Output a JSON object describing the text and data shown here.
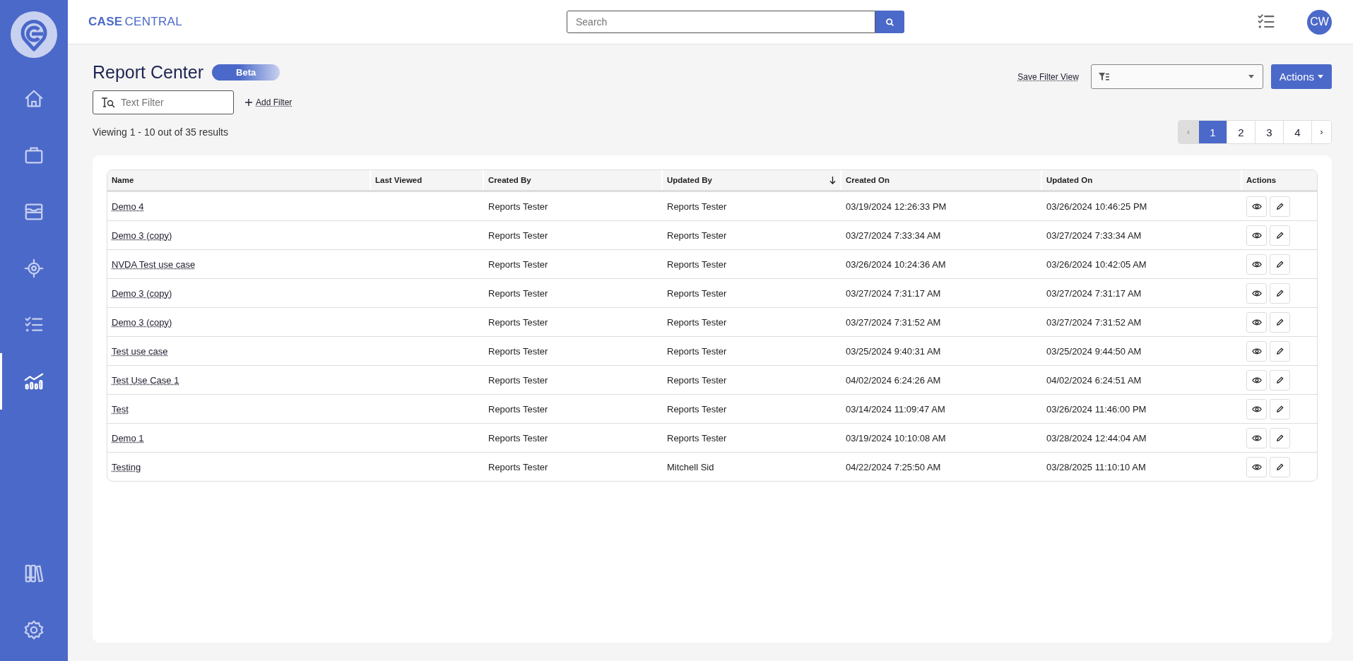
{
  "sidebar": {
    "items": [
      {
        "kind": "home",
        "selected": false
      },
      {
        "kind": "briefcase",
        "selected": false
      },
      {
        "kind": "inbox",
        "selected": false
      },
      {
        "kind": "target",
        "selected": false
      },
      {
        "kind": "checklist",
        "selected": false
      },
      {
        "kind": "chart",
        "selected": true
      }
    ],
    "bottom_items": [
      {
        "kind": "books",
        "selected": false
      },
      {
        "kind": "settings",
        "selected": false
      }
    ]
  },
  "header": {
    "brand_bold": "CASE",
    "brand_light": "CENTRAL",
    "search": {
      "placeholder": "Search"
    },
    "avatar": "CW"
  },
  "page": {
    "title": "Report Center",
    "badge": "Beta",
    "text_filter": {
      "placeholder": "Text Filter"
    },
    "add_filter": "Add Filter",
    "save_filter_view": "Save Filter View",
    "actions_button": "Actions",
    "result_summary": "Viewing 1 - 10 out of 35 results"
  },
  "pagination": {
    "prev": {
      "label": "‹",
      "disabled": true
    },
    "next": {
      "label": "›",
      "disabled": false
    },
    "pages": [
      {
        "label": "1",
        "selected": true
      },
      {
        "label": "2",
        "selected": false
      },
      {
        "label": "3",
        "selected": false
      },
      {
        "label": "4",
        "selected": false
      }
    ]
  },
  "table": {
    "columns": [
      {
        "label": "Name",
        "sorted": false
      },
      {
        "label": "Last Viewed",
        "sorted": false
      },
      {
        "label": "Created By",
        "sorted": false
      },
      {
        "label": "Updated By",
        "sorted": true
      },
      {
        "label": "Created On",
        "sorted": false
      },
      {
        "label": "Updated On",
        "sorted": false
      },
      {
        "label": "Actions",
        "sorted": false
      }
    ],
    "rows": [
      {
        "name": "Demo 4",
        "created_by": "Reports Tester",
        "updated_by": "Reports Tester",
        "created_on": "03/19/2024 12:26:33 PM",
        "updated_on": "03/26/2024 10:46:25 PM"
      },
      {
        "name": "Demo 3 (copy)",
        "created_by": "Reports Tester",
        "updated_by": "Reports Tester",
        "created_on": "03/27/2024 7:33:34 AM",
        "updated_on": "03/27/2024 7:33:34 AM"
      },
      {
        "name": "NVDA Test use case",
        "created_by": "Reports Tester",
        "updated_by": "Reports Tester",
        "created_on": "03/26/2024 10:24:36 AM",
        "updated_on": "03/26/2024 10:42:05 AM"
      },
      {
        "name": "Demo 3 (copy)",
        "created_by": "Reports Tester",
        "updated_by": "Reports Tester",
        "created_on": "03/27/2024 7:31:17 AM",
        "updated_on": "03/27/2024 7:31:17 AM"
      },
      {
        "name": "Demo 3 (copy)",
        "created_by": "Reports Tester",
        "updated_by": "Reports Tester",
        "created_on": "03/27/2024 7:31:52 AM",
        "updated_on": "03/27/2024 7:31:52 AM"
      },
      {
        "name": "Test use case",
        "created_by": "Reports Tester",
        "updated_by": "Reports Tester",
        "created_on": "03/25/2024 9:40:31 AM",
        "updated_on": "03/25/2024 9:44:50 AM"
      },
      {
        "name": "Test Use Case 1",
        "created_by": "Reports Tester",
        "updated_by": "Reports Tester",
        "created_on": "04/02/2024 6:24:26 AM",
        "updated_on": "04/02/2024 6:24:51 AM"
      },
      {
        "name": "Test",
        "created_by": "Reports Tester",
        "updated_by": "Reports Tester",
        "created_on": "03/14/2024 11:09:47 AM",
        "updated_on": "03/26/2024 11:46:00 PM"
      },
      {
        "name": "Demo 1",
        "created_by": "Reports Tester",
        "updated_by": "Reports Tester",
        "created_on": "03/19/2024 10:10:08 AM",
        "updated_on": "03/28/2024 12:44:04 AM"
      },
      {
        "name": "Testing",
        "created_by": "Reports Tester",
        "updated_by": "Mitchell Sid",
        "created_on": "04/22/2024 7:25:50 AM",
        "updated_on": "03/28/2025 11:10:10 AM"
      }
    ]
  }
}
